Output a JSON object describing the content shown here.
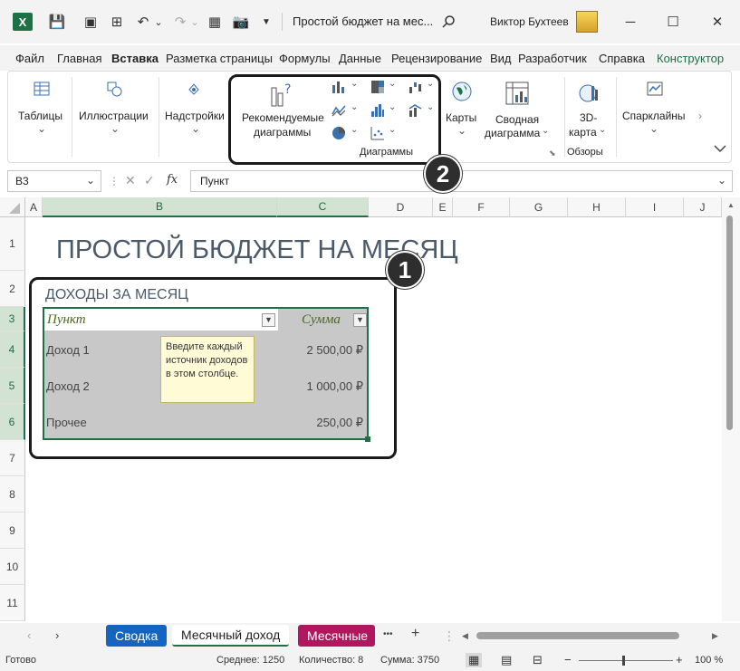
{
  "app": {
    "doc_title": "Простой бюджет на мес...",
    "user_name": "Виктор Бухтеев",
    "undo_caret": "⌄",
    "redo_caret": "⌄"
  },
  "tabs": [
    "Файл",
    "Главная",
    "Вставка",
    "Разметка страницы",
    "Формулы",
    "Данные",
    "Рецензирование",
    "Вид",
    "Разработчик",
    "Справка",
    "Конструктор"
  ],
  "ribbon": {
    "tables": "Таблицы",
    "illustrations": "Иллюстрации",
    "addins": "Надстройки",
    "recommended_l1": "Рекомендуемые",
    "recommended_l2": "диаграммы",
    "charts_group": "Диаграммы",
    "maps": "Карты",
    "pivot_l1": "Сводная",
    "pivot_l2": "диаграмма",
    "map3d_l1": "3D-",
    "map3d_l2": "карта",
    "tours_group": "Обзоры",
    "sparklines": "Спарклайны",
    "caret": "⌄"
  },
  "formula_bar": {
    "name_box": "B3",
    "fx": "fx",
    "value": "Пункт"
  },
  "columns": [
    "A",
    "B",
    "C",
    "D",
    "E",
    "F",
    "G",
    "H",
    "I",
    "J"
  ],
  "rows": [
    "1",
    "2",
    "3",
    "4",
    "5",
    "6",
    "7",
    "8",
    "9",
    "10",
    "11"
  ],
  "sheet": {
    "title": "ПРОСТОЙ БЮДЖЕТ НА МЕСЯЦ",
    "subtitle": "ДОХОДЫ ЗА МЕСЯЦ",
    "header_item": "Пункт",
    "header_sum": "Сумма",
    "rows": [
      {
        "item": "Доход 1",
        "sum": "2 500,00 ₽"
      },
      {
        "item": "Доход 2",
        "sum": "1 000,00 ₽"
      },
      {
        "item": "Прочее",
        "sum": "250,00 ₽"
      }
    ],
    "tooltip": "Введите каждый источник доходов в этом столбце."
  },
  "callouts": {
    "one": "1",
    "two": "2"
  },
  "sheet_tabs": [
    "Сводка",
    "Месячный доход",
    "Месячные"
  ],
  "sheet_more": "•••",
  "sheet_add": "+",
  "status": {
    "ready": "Готово",
    "average": "Среднее: 1250",
    "count": "Количество: 8",
    "sum": "Сумма: 3750",
    "zoom": "100 %",
    "minus": "−",
    "plus": "+"
  },
  "colors": {
    "green_accent": "#1e7145",
    "selection_fill": "#c8c8c8",
    "tab_summary": "#1565c0",
    "tab_monthly": "#b0175e",
    "title_color": "#4a5a6a"
  }
}
